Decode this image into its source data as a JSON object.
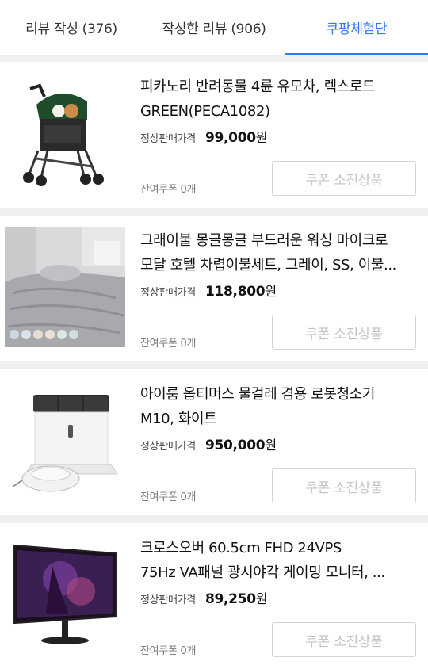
{
  "tabs": [
    {
      "label": "리뷰 작성 (376)",
      "active": false
    },
    {
      "label": "작성한 리뷰 (906)",
      "active": false
    },
    {
      "label": "쿠팡체험단",
      "active": true
    }
  ],
  "price_label": "정상판매가격",
  "currency": "원",
  "products": [
    {
      "name_line1": "피카노리 반려동물 4륜 유모차, 렉스로드",
      "name_line2": "GREEN(PECA1082)",
      "price": "99,000",
      "remaining": "잔여쿠폰 0개",
      "button": "쿠폰 소진상품",
      "image": "pet-stroller-image"
    },
    {
      "name_line1": "그래이불 몽글몽글 부드러운 워싱 마이크로",
      "name_line2": "모달 호텔 차렵이불세트, 그레이, SS, 이불...",
      "price": "118,800",
      "remaining": "잔여쿠폰 0개",
      "button": "쿠폰 소진상품",
      "image": "bedding-image"
    },
    {
      "name_line1": "아이룸 옵티머스 물걸레 겸용 로봇청소기",
      "name_line2": "M10, 화이트",
      "price": "950,000",
      "remaining": "잔여쿠폰 0개",
      "button": "쿠폰 소진상품",
      "image": "robot-vacuum-image"
    },
    {
      "name_line1": "크로스오버 60.5cm FHD 24VPS",
      "name_line2": "75Hz VA패널 광시야각 게이밍 모니터, ...",
      "price": "89,250",
      "remaining": "잔여쿠폰 0개",
      "button": "쿠폰 소진상품",
      "image": "monitor-image"
    }
  ]
}
